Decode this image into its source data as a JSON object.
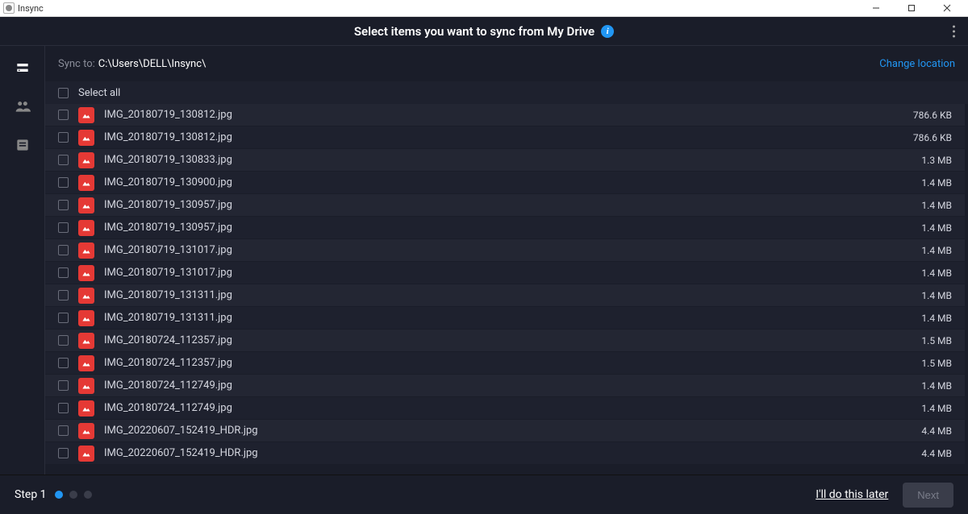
{
  "window": {
    "app_name": "Insync"
  },
  "header": {
    "title": "Select items you want to sync from My Drive"
  },
  "sync": {
    "label": "Sync to:",
    "path": "C:\\Users\\DELL\\Insync\\",
    "change_link": "Change location"
  },
  "select_all_label": "Select all",
  "files": [
    {
      "name": "IMG_20180719_130812.jpg",
      "size": "786.6 KB"
    },
    {
      "name": "IMG_20180719_130812.jpg",
      "size": "786.6 KB"
    },
    {
      "name": "IMG_20180719_130833.jpg",
      "size": "1.3 MB"
    },
    {
      "name": "IMG_20180719_130900.jpg",
      "size": "1.4 MB"
    },
    {
      "name": "IMG_20180719_130957.jpg",
      "size": "1.4 MB"
    },
    {
      "name": "IMG_20180719_130957.jpg",
      "size": "1.4 MB"
    },
    {
      "name": "IMG_20180719_131017.jpg",
      "size": "1.4 MB"
    },
    {
      "name": "IMG_20180719_131017.jpg",
      "size": "1.4 MB"
    },
    {
      "name": "IMG_20180719_131311.jpg",
      "size": "1.4 MB"
    },
    {
      "name": "IMG_20180719_131311.jpg",
      "size": "1.4 MB"
    },
    {
      "name": "IMG_20180724_112357.jpg",
      "size": "1.5 MB"
    },
    {
      "name": "IMG_20180724_112357.jpg",
      "size": "1.5 MB"
    },
    {
      "name": "IMG_20180724_112749.jpg",
      "size": "1.4 MB"
    },
    {
      "name": "IMG_20180724_112749.jpg",
      "size": "1.4 MB"
    },
    {
      "name": "IMG_20220607_152419_HDR.jpg",
      "size": "4.4 MB"
    },
    {
      "name": "IMG_20220607_152419_HDR.jpg",
      "size": "4.4 MB"
    }
  ],
  "footer": {
    "step_label": "Step 1",
    "later": "I'll do this later",
    "next": "Next"
  }
}
